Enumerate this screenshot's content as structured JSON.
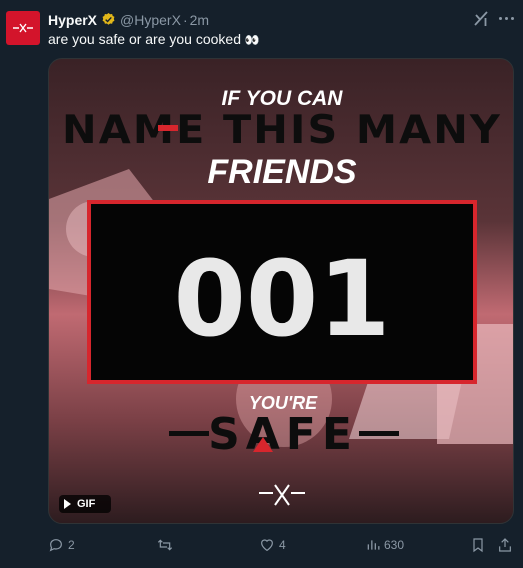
{
  "tweet": {
    "author": {
      "display_name": "HyperX",
      "handle": "@HyperX",
      "verified": true
    },
    "time": "2m",
    "separator": "·",
    "text": "are you safe or are you cooked",
    "text_emoji": "👀"
  },
  "media": {
    "type": "GIF",
    "gif_label": "GIF",
    "headline_1": "IF YOU CAN",
    "headline_2": "NAME THIS MANY",
    "headline_3": "FRIENDS",
    "counter": "001",
    "subline": "YOU'RE",
    "status_word": "SAFE",
    "colors": {
      "accent": "#d7262d",
      "counter_bg": "#050505",
      "counter_text": "#e8e8e8"
    }
  },
  "actions": {
    "replies": "2",
    "reposts": "",
    "likes": "4",
    "views": "630"
  },
  "colors": {
    "background": "#15202b",
    "text": "#f7f9f9",
    "muted": "#8b98a5",
    "brand": "#d3142b",
    "verified": "#e2b719"
  }
}
